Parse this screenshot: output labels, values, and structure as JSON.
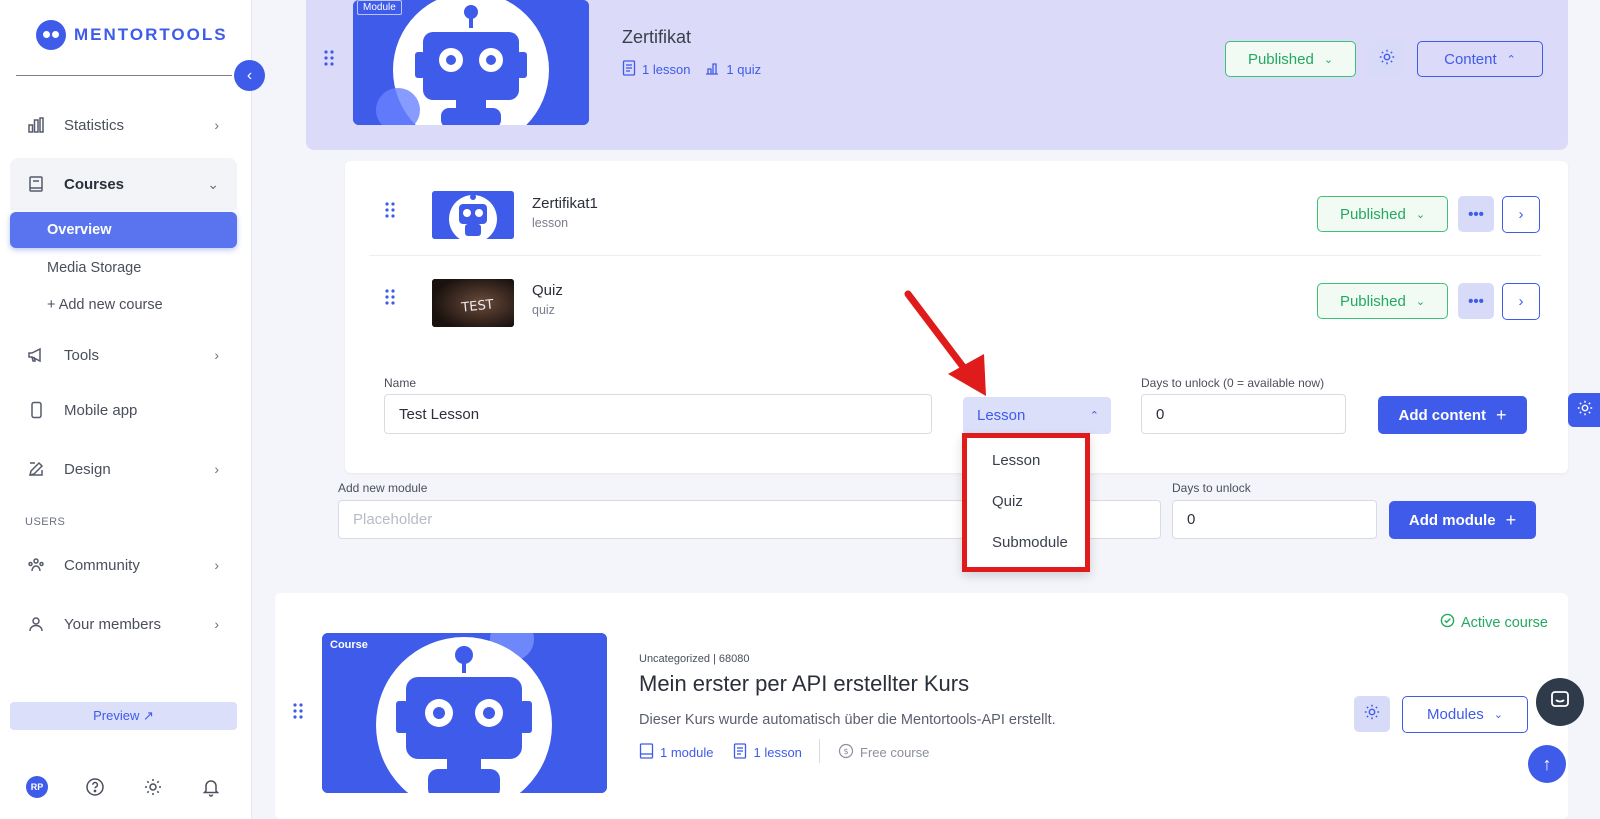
{
  "app": {
    "logo_text": "MENTORTOOLS"
  },
  "sidebar": {
    "collapse_icon": "chevron-left-icon",
    "items": [
      {
        "label": "Statistics",
        "icon": "bar-chart-icon"
      },
      {
        "label": "Courses",
        "icon": "book-icon"
      },
      {
        "label": "Tools",
        "icon": "megaphone-icon"
      },
      {
        "label": "Mobile app",
        "icon": "mobile-icon"
      },
      {
        "label": "Design",
        "icon": "edit-icon"
      },
      {
        "label": "Community",
        "icon": "community-icon"
      },
      {
        "label": "Your members",
        "icon": "user-icon"
      }
    ],
    "courses_sub": [
      "Overview",
      "Media Storage",
      "+ Add new course"
    ],
    "section_users": "USERS",
    "preview": "Preview ↗",
    "user_initials": "RP"
  },
  "module": {
    "tag": "Module",
    "title": "Zertifikat",
    "lessons": "1 lesson",
    "quizzes": "1 quiz",
    "status": "Published",
    "content_btn": "Content"
  },
  "lessons": [
    {
      "title": "Zertifikat1",
      "type": "lesson",
      "status": "Published",
      "thumb": "robot"
    },
    {
      "title": "Quiz",
      "type": "quiz",
      "status": "Published",
      "thumb": "test-sign"
    }
  ],
  "add_content": {
    "name_label": "Name",
    "name_value": "Test Lesson",
    "type_selected": "Lesson",
    "type_options": [
      "Lesson",
      "Quiz",
      "Submodule"
    ],
    "days_label": "Days to unlock (0 = available now)",
    "days_value": "0",
    "button": "Add content"
  },
  "add_module": {
    "label": "Add new module",
    "placeholder": "Placeholder",
    "days_label": "Days to unlock",
    "days_value": "0",
    "button": "Add module"
  },
  "course": {
    "tag": "Course",
    "status": "Active course",
    "meta": "Uncategorized | 68080",
    "title": "Mein erster per API erstellter Kurs",
    "description": "Dieser Kurs wurde automatisch über die Mentortools-API erstellt.",
    "modules_count": "1 module",
    "lessons_count": "1 lesson",
    "price": "Free course",
    "modules_btn": "Modules"
  },
  "colors": {
    "accent": "#3f5bea",
    "published": "#24a862",
    "highlight": "#e01b1b"
  }
}
